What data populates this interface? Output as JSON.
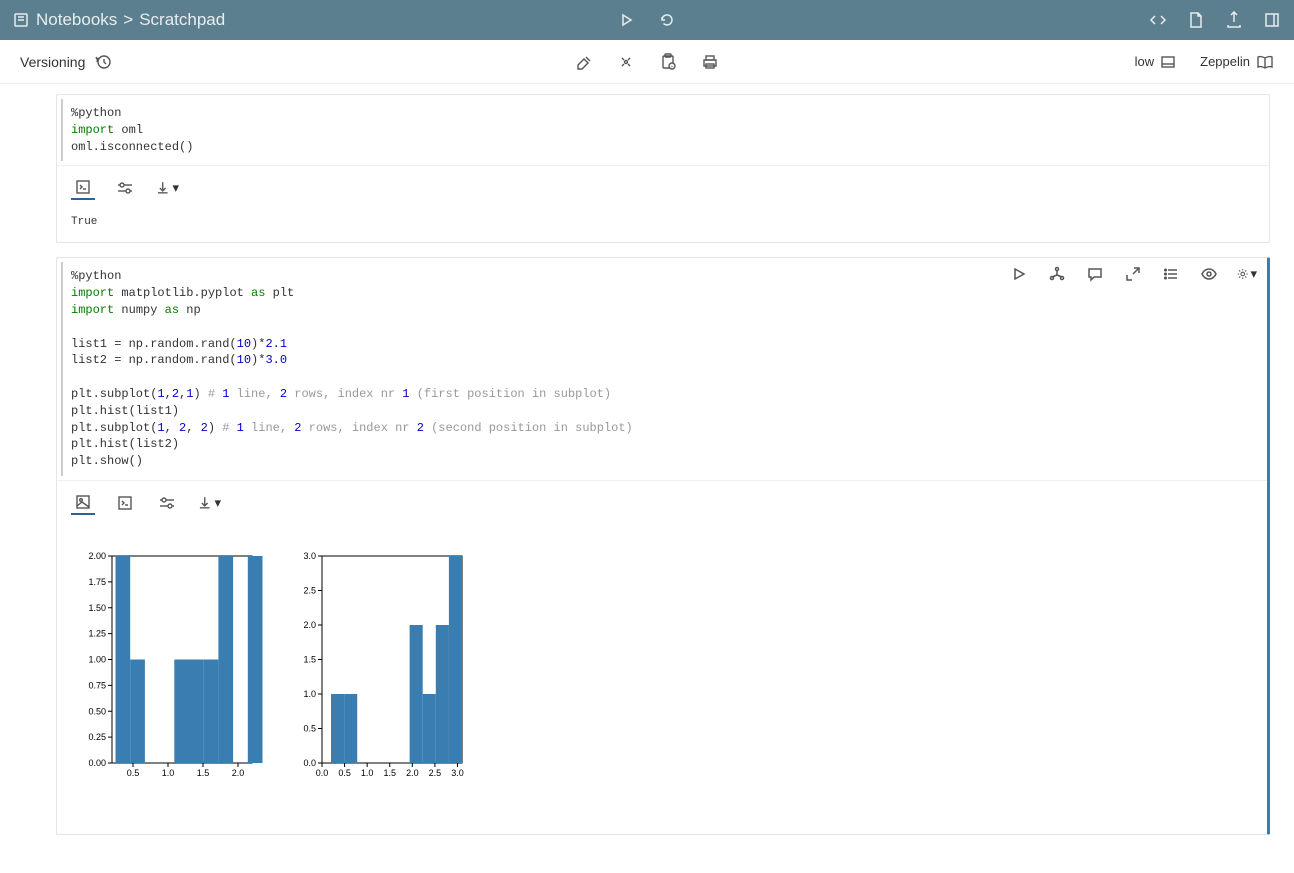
{
  "header": {
    "breadcrumb_root": "Notebooks",
    "breadcrumb_sep": ">",
    "breadcrumb_leaf": "Scratchpad"
  },
  "subheader": {
    "versioning": "Versioning",
    "priority": "low",
    "reader": "Zeppelin"
  },
  "cell1": {
    "code_line1_prefix": "%python",
    "code_line2_kw": "import",
    "code_line2_mod": " oml",
    "code_line3": "oml.isconnected()",
    "output": "True"
  },
  "cell2": {
    "code_text": "%python\nimport matplotlib.pyplot as plt\nimport numpy as np\n\nlist1 = np.random.rand(10)*2.1\nlist2 = np.random.rand(10)*3.0\n\nplt.subplot(1,2,1) # 1 line, 2 rows, index nr 1 (first position in subplot)\nplt.hist(list1)\nplt.subplot(1, 2, 2) # 1 line, 2 rows, index nr 2 (second position in subplot)\nplt.hist(list2)\nplt.show()"
  },
  "chart_data": [
    {
      "type": "bar",
      "subplot": 1,
      "description": "histogram of list1 (np.random.rand(10)*2.1)",
      "bin_edges": [
        0.25,
        0.46,
        0.67,
        0.88,
        1.09,
        1.3,
        1.51,
        1.72,
        1.93,
        2.14
      ],
      "values": [
        2.0,
        1.0,
        0.0,
        0.0,
        1.0,
        1.0,
        1.0,
        2.0,
        0.0,
        2.0
      ],
      "x_ticks": [
        0.5,
        1.0,
        1.5,
        2.0
      ],
      "y_ticks": [
        0.0,
        0.25,
        0.5,
        0.75,
        1.0,
        1.25,
        1.5,
        1.75,
        2.0
      ],
      "y_tick_labels": [
        "0.00",
        "0.25",
        "0.50",
        "0.75",
        "1.00",
        "1.25",
        "1.50",
        "1.75",
        "2.00"
      ],
      "xlim": [
        0.2,
        2.2
      ],
      "ylim": [
        0,
        2.0
      ]
    },
    {
      "type": "bar",
      "subplot": 2,
      "description": "histogram of list2 (np.random.rand(10)*3.0)",
      "bin_edges": [
        0.2,
        0.49,
        0.78,
        1.07,
        1.36,
        1.65,
        1.94,
        2.23,
        2.52,
        2.81,
        3.1
      ],
      "values": [
        1.0,
        1.0,
        0.0,
        0.0,
        0.0,
        0.0,
        2.0,
        1.0,
        2.0,
        3.0
      ],
      "x_ticks": [
        0.0,
        0.5,
        1.0,
        1.5,
        2.0,
        2.5,
        3.0
      ],
      "y_ticks": [
        0.0,
        0.5,
        1.0,
        1.5,
        2.0,
        2.5,
        3.0
      ],
      "y_tick_labels": [
        "0.0",
        "0.5",
        "1.0",
        "1.5",
        "2.0",
        "2.5",
        "3.0"
      ],
      "xlim": [
        0.0,
        3.1
      ],
      "ylim": [
        0,
        3.0
      ]
    }
  ]
}
